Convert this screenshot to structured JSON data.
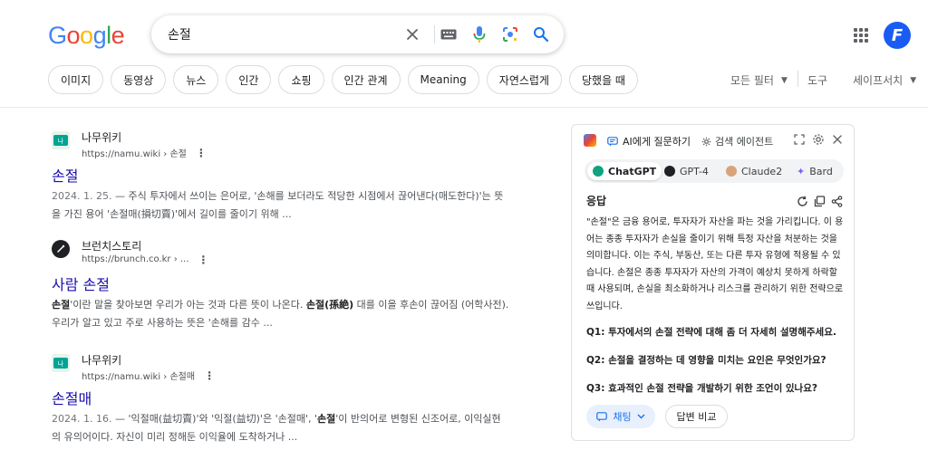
{
  "search": {
    "query": "손절"
  },
  "chips": [
    "이미지",
    "동영상",
    "뉴스",
    "인간",
    "쇼핑",
    "인간 관계",
    "Meaning",
    "자연스럽게",
    "당했을 때"
  ],
  "toolbar": {
    "all_filters": "모든 필터",
    "tools": "도구",
    "safesearch": "세이프서치"
  },
  "results": [
    {
      "site": "나무위키",
      "url": "https://namu.wiki › 손절",
      "title": "손절",
      "date": "2024. 1. 25.",
      "snippet": " — 주식 투자에서 쓰이는 은어로, '손해를 보더라도 적당한 시점에서 끊어낸다(매도한다)'는 뜻을 가진 용어 '손절매(損切賣)'에서 길이를 줄이기 위해 ..."
    },
    {
      "site": "브런치스토리",
      "url": "https://brunch.co.kr › ...",
      "title": "사람 손절",
      "snippet_b1": "손절",
      "snippet_p1": "'이란 말을 찾아보면 우리가 아는 것과 다른 뜻이 나온다. ",
      "snippet_b2": "손절(孫絶)",
      "snippet_p2": " 대를 이을 후손이 끊어짐 (어학사전). 우리가 알고 있고 주로 사용하는 뜻은 '손해를 감수 ..."
    },
    {
      "site": "나무위키",
      "url": "https://namu.wiki › 손절매",
      "title": "손절매",
      "date": "2024. 1. 16.",
      "snippet_p1": " — '익절매(益切賣)'와 '익절(益切)'은 '손절매', '",
      "snippet_b1": "손절",
      "snippet_p2": "'이 반의어로 변형된 신조어로, 이익실현의 유의어이다. 자신이 미리 정해둔 이익율에 도착하거나 ..."
    }
  ],
  "panel": {
    "tab_ask": "AI에게 질문하기",
    "tab_agent": "검색 에이전트",
    "models": [
      "ChatGPT",
      "GPT-4",
      "Claude2",
      "Bard"
    ],
    "answer_label": "응답",
    "answer": "\"손절\"은 금융 용어로, 투자자가 자산을 파는 것을 가리킵니다. 이 용어는 종종 투자자가 손실을 줄이기 위해 특정 자산을 처분하는 것을 의미합니다. 이는 주식, 부동산, 또는 다른 투자 유형에 적용될 수 있습니다. 손절은 종종 투자자가 자산의 가격이 예상치 못하게 하락할 때 사용되며, 손실을 최소화하거나 리스크를 관리하기 위한 전략으로 쓰입니다.",
    "questions": [
      "Q1: 투자에서의 손절 전략에 대해 좀 더 자세히 설명해주세요.",
      "Q2: 손절을 결정하는 데 영향을 미치는 요인은 무엇인가요?",
      "Q3: 효과적인 손절 전략을 개발하기 위한 조언이 있나요?"
    ],
    "chat_button": "채팅",
    "compare_button": "답변 비교"
  },
  "colors": {
    "link": "#1a0dab",
    "accent": "#1a73e8",
    "avatar": "#1a5cf3"
  }
}
